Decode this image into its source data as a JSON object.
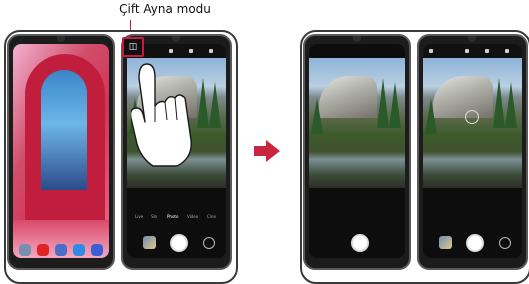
{
  "callout": {
    "label": "Çift Ayna modu"
  },
  "camera": {
    "modes": [
      "Live",
      "Slo",
      "Photo",
      "Video",
      "Cine"
    ],
    "active_mode": "Photo"
  },
  "colors": {
    "accent_arrow": "#c8253f",
    "callout_line": "#c51b3c",
    "highlight_box": "#c51b3c"
  },
  "icons": [
    "dual-mirror-mode-icon",
    "hand-pointer-icon",
    "right-arrow-icon",
    "shutter-button-icon",
    "camera-switch-icon",
    "gallery-thumbnail-icon"
  ]
}
